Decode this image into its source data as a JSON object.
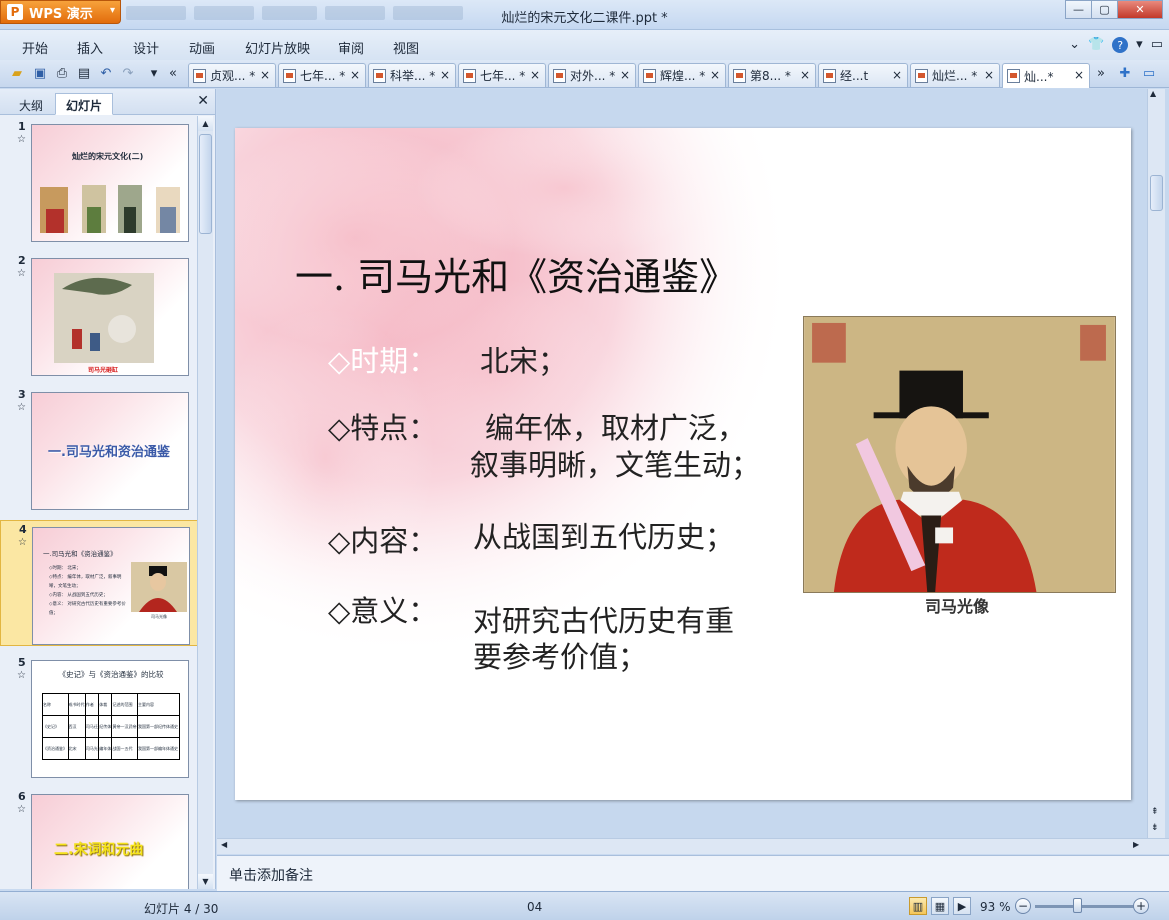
{
  "app": {
    "name": "WPS 演示",
    "window_title": "灿烂的宋元文化二课件.ppt *"
  },
  "colors": {
    "accent": "#e26c0c",
    "selected_thumb": "#fbe7a3",
    "ribbon": "#d6e3f3"
  },
  "menu": [
    "开始",
    "插入",
    "设计",
    "动画",
    "幻灯片放映",
    "审阅",
    "视图"
  ],
  "doc_tabs": [
    "贞观... *",
    "七年... *",
    "科举... *",
    "七年... *",
    "对外... *",
    "辉煌... *",
    "第8... *",
    "经...t",
    "灿烂... *",
    "灿...*"
  ],
  "panel": {
    "tab_outline": "大纲",
    "tab_slides": "幻灯片"
  },
  "thumbs": [
    {
      "num": "1",
      "title": "灿烂的宋元文化(二)"
    },
    {
      "num": "2",
      "caption": "司马光砸缸"
    },
    {
      "num": "3",
      "title": "一.司马光和资治通鉴"
    },
    {
      "num": "4",
      "title": "一.司马光和《资治通鉴》",
      "lines": [
        "◇时期： 北宋；",
        "◇特点： 编年体，取材广泛，叙事明晰，文笔生动；",
        "◇内容： 从战国到五代历史；",
        "◇意义： 对研究古代历史有重要参考价值；"
      ],
      "caption": "司马光像"
    },
    {
      "num": "5",
      "title": "《史记》与《资治通鉴》的比较",
      "table": [
        [
          "名称",
          "成书时代",
          "作者",
          "体裁",
          "记述的范围",
          "主要内容"
        ],
        [
          "《史记》",
          "西汉",
          "司马迁",
          "纪传体",
          "黄帝—汉武帝",
          "我国第一部纪传体通史"
        ],
        [
          "《资治通鉴》",
          "北宋",
          "司马光",
          "编年体",
          "战国—五代",
          "我国第一部编年体通史"
        ]
      ]
    },
    {
      "num": "6",
      "title": "二.宋词和元曲"
    }
  ],
  "slide": {
    "title": "一. 司马光和《资治通鉴》",
    "period_label": "◇时期：",
    "period_value": "北宋；",
    "feature_label": "◇特点：",
    "feature_value_1": "编年体，取材广泛，",
    "feature_value_2": "叙事明晰，文笔生动；",
    "content_label": "◇内容：",
    "content_value": "从战国到五代历史；",
    "meaning_label": "◇意义：",
    "meaning_value_1": "对研究古代历史有重",
    "meaning_value_2": "要参考价值；",
    "image_caption": "司马光像"
  },
  "notes_placeholder": "单击添加备注",
  "status": {
    "slide_counter": "幻灯片 4 / 30",
    "theme": "04",
    "zoom": "93 %"
  }
}
